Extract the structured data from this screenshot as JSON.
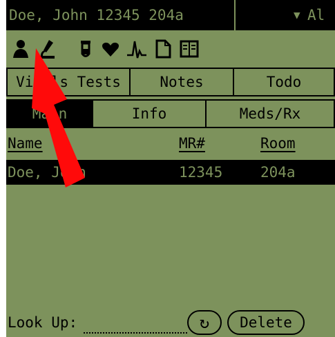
{
  "header": {
    "title": "Doe, John 12345 204a",
    "dropdown_label": "Al",
    "dropdown_arrow": "▼"
  },
  "toolbar_icons": [
    "person-icon",
    "microscope-icon",
    "test-tube-icon",
    "heart-icon",
    "ekg-icon",
    "document-icon",
    "book-icon"
  ],
  "tabs_row1": [
    "Vitals",
    "Tests",
    "Notes",
    "Todo"
  ],
  "tabs_row2": [
    "Main",
    "Info",
    "Meds/Rx"
  ],
  "active_tab": "Main",
  "list": {
    "columns": [
      "Name",
      "MR#",
      "Room"
    ],
    "rows": [
      {
        "name": "Doe, John",
        "mr": "12345",
        "room": "204a",
        "selected": true
      }
    ]
  },
  "bottom": {
    "lookup_label": "Look Up:",
    "lookup_value": "",
    "refresh_symbol": "↻",
    "delete_label": "Delete"
  },
  "colors": {
    "screen": "#7d925c",
    "ink": "#000000",
    "annotation_arrow": "#ff0a0a"
  }
}
